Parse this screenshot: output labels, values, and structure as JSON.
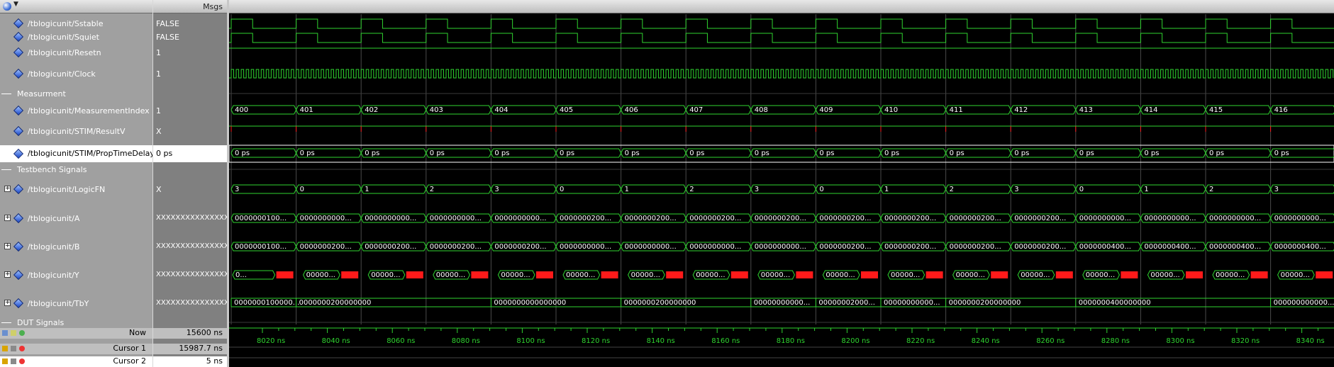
{
  "header": {
    "msgs_label": "Msgs"
  },
  "signals": [
    {
      "name": "/tblogicunit/Sstable",
      "value": "FALSE"
    },
    {
      "name": "/tblogicunit/Squiet",
      "value": "FALSE"
    },
    {
      "name": "/tblogicunit/Resetn",
      "value": "1"
    },
    {
      "name": "/tblogicunit/Clock",
      "value": "1"
    },
    {
      "name": "/tblogicunit/MeasurementIndex",
      "value": "1"
    },
    {
      "name": "/tblogicunit/STIM/ResultV",
      "value": "X"
    },
    {
      "name": "/tblogicunit/STIM/PropTimeDelay",
      "value": "0 ps"
    },
    {
      "name": "/tblogicunit/LogicFN",
      "value": "X"
    },
    {
      "name": "/tblogicunit/A",
      "value": "XXXXXXXXXXXXXXXX"
    },
    {
      "name": "/tblogicunit/B",
      "value": "XXXXXXXXXXXXXXXX"
    },
    {
      "name": "/tblogicunit/Y",
      "value": "XXXXXXXXXXXXXXXX"
    },
    {
      "name": "/tblogicunit/TbY",
      "value": "XXXXXXXXXXXXXXXX"
    }
  ],
  "dividers": [
    "Measurment",
    "Testbench Signals",
    "DUT Signals"
  ],
  "status": {
    "now_label": "Now",
    "now_value": "15600 ns",
    "cursor1_label": "Cursor 1",
    "cursor1_value": "15987.7 ns",
    "cursor2_label": "Cursor 2",
    "cursor2_value": "5 ns"
  },
  "timeline": {
    "ticks": [
      "8020 ns",
      "8040 ns",
      "8060 ns",
      "8080 ns",
      "8100 ns",
      "8120 ns",
      "8140 ns",
      "8160 ns",
      "8180 ns",
      "8200 ns",
      "8220 ns",
      "8240 ns",
      "8260 ns",
      "8280 ns",
      "8300 ns",
      "8320 ns",
      "8340 ns"
    ]
  },
  "waves": {
    "measurement_index": [
      "400",
      "401",
      "402",
      "403",
      "404",
      "405",
      "406",
      "407",
      "408",
      "409",
      "410",
      "411",
      "412",
      "413",
      "414",
      "415",
      "416"
    ],
    "prop_time_delay": [
      "0 ps",
      "0 ps",
      "0 ps",
      "0 ps",
      "0 ps",
      "0 ps",
      "0 ps",
      "0 ps",
      "0 ps",
      "0 ps",
      "0 ps",
      "0 ps",
      "0 ps",
      "0 ps",
      "0 ps",
      "0 ps",
      "0 ps"
    ],
    "logic_fn": [
      "3",
      "0",
      "1",
      "2",
      "3",
      "0",
      "1",
      "2",
      "3",
      "0",
      "1",
      "2",
      "3",
      "0",
      "1",
      "2",
      "3"
    ],
    "a": [
      "0000000100...",
      "0000000000...",
      "0000000000...",
      "0000000000...",
      "0000000000...",
      "0000000200...",
      "0000000200...",
      "0000000200...",
      "0000000200...",
      "0000000200...",
      "0000000200...",
      "0000000200...",
      "0000000200...",
      "0000000000...",
      "0000000000...",
      "0000000000...",
      "0000000000..."
    ],
    "b": [
      "0000000100...",
      "0000000200...",
      "0000000200...",
      "0000000200...",
      "0000000200...",
      "0000000000...",
      "0000000000...",
      "0000000000...",
      "0000000000...",
      "0000000200...",
      "0000000200...",
      "0000000200...",
      "0000000200...",
      "0000000400...",
      "0000000400...",
      "0000000400...",
      "0000000400..."
    ],
    "y": [
      "0...",
      "00000...",
      "00000...",
      "00000...",
      "00000...",
      "00000...",
      "00000...",
      "00000...",
      "00000...",
      "00000...",
      "00000...",
      "00000...",
      "00000...",
      "00000...",
      "00000...",
      "00000...",
      "00000..."
    ],
    "tby": [
      {
        "label": "0000000100000...",
        "span": 1
      },
      {
        "label": "0000000200000000",
        "span": 3
      },
      {
        "label": "0000000000000000",
        "span": 2
      },
      {
        "label": "0000000200000000",
        "span": 2
      },
      {
        "label": "00000000000...",
        "span": 1
      },
      {
        "label": "00000002000...",
        "span": 1
      },
      {
        "label": "00000000000...",
        "span": 1
      },
      {
        "label": "0000000200000000",
        "span": 2
      },
      {
        "label": "0000000400000000",
        "span": 3
      },
      {
        "label": "000000000000...",
        "span": 1
      }
    ]
  },
  "colors": {
    "wave": "#2fd32f",
    "x_state": "#ff1a1a",
    "cursor": "#d8d8d8",
    "grid": "#4a4a4a"
  }
}
